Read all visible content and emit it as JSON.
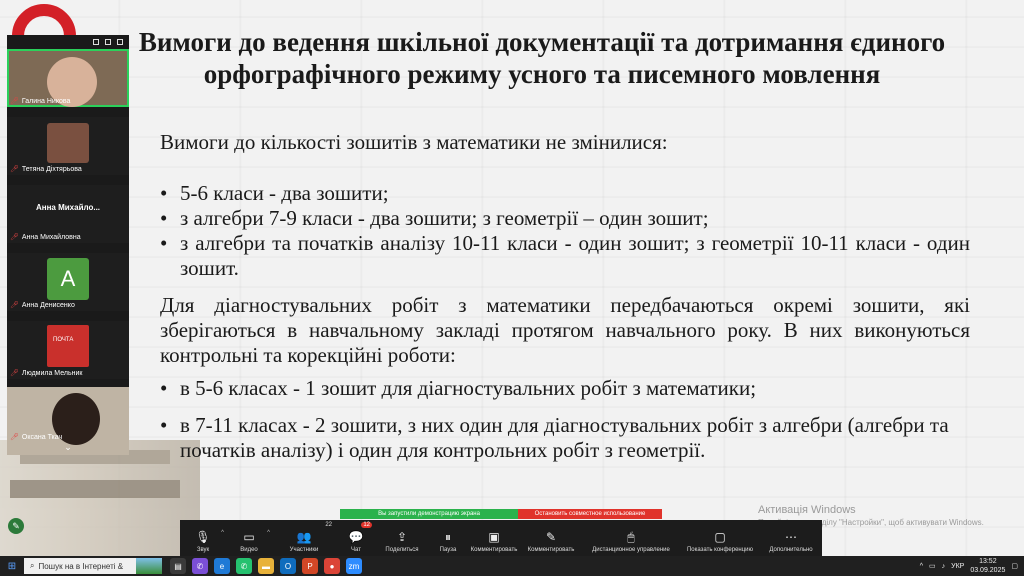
{
  "slide": {
    "title": "Вимоги до ведення шкільної документації та дотримання єдиного орфографічного режиму  усного та писемного мовлення",
    "intro": "Вимоги до кількості зошитів з математики не змінилися:",
    "bullets1": [
      "5-6 класи - два зошити;",
      "з алгебри 7-9 класи - два зошити; з геометрії – один зошит;",
      "з алгебри та початків аналізу 10-11 класи - один зошит; з геометрії 10-11 класи - один зошит."
    ],
    "paragraph": "Для діагностувальних  робіт з математики передбачаються окремі зошити, які зберігаються в навчальному закладі протягом навчального року. В них виконуються контрольні та корекційні роботи:",
    "bullets2": [
      "в 5-6 класах - 1 зошит для  діагностувальних  робіт з математики;",
      "в 7-11 класах - 2 зошити, з них один для діагностувальних робіт з алгебри (алгебри та початків аналізу) і один для контрольних робіт з геометрії."
    ]
  },
  "participants": [
    {
      "name": "Галина Никова",
      "type": "video",
      "icon": "person-video"
    },
    {
      "name": "Тетяна Дiхтярьова",
      "type": "photo",
      "icon": "avatar-photo"
    },
    {
      "name": "Анна Михайловна",
      "display_big": "Анна  Михайло...",
      "type": "name"
    },
    {
      "name": "Анна Денисенко",
      "type": "letter",
      "letter": "A",
      "color": "#4c9b3f"
    },
    {
      "name": "Людмила Мельник",
      "type": "image",
      "icon": "mailbox-image"
    },
    {
      "name": "Оксана Ткач",
      "type": "video",
      "icon": "person-video"
    }
  ],
  "share_banner": {
    "green": "Вы запустили демонстрацию экрана",
    "red": "Остановить совместное использование"
  },
  "watermark": {
    "title": "Активація Windows",
    "sub": "Перейдіть до розділу \"Настройки\", щоб активувати Windows."
  },
  "zoom_toolbar": [
    {
      "label": "Звук",
      "icon": "microphone-icon",
      "glyph": "🎙"
    },
    {
      "label": "Видео",
      "icon": "video-camera-icon",
      "glyph": "▭"
    },
    {
      "label": "Участники",
      "icon": "participants-icon",
      "glyph": "👥",
      "badge": "22"
    },
    {
      "label": "Чат",
      "icon": "chat-icon",
      "glyph": "💬",
      "badge": "12"
    },
    {
      "label": "Поделиться",
      "icon": "share-icon",
      "glyph": "⇪"
    },
    {
      "label": "Пауза",
      "icon": "pause-icon",
      "glyph": "⏸"
    },
    {
      "label": "Комментировать",
      "icon": "annotate-icon",
      "glyph": "▣"
    },
    {
      "label": "Комментировать",
      "icon": "pen-icon",
      "glyph": "✎"
    },
    {
      "label": "Дистанционное управление",
      "icon": "remote-control-icon",
      "glyph": "🖱"
    },
    {
      "label": "Показать конференцию",
      "icon": "show-meeting-icon",
      "glyph": "▢"
    },
    {
      "label": "Дополнительно",
      "icon": "more-icon",
      "glyph": "⋯"
    }
  ],
  "taskbar": {
    "search_placeholder": "Пошук на в Інтернеті &",
    "language": "УКР",
    "time": "13:52",
    "date": "03.09.2025"
  }
}
